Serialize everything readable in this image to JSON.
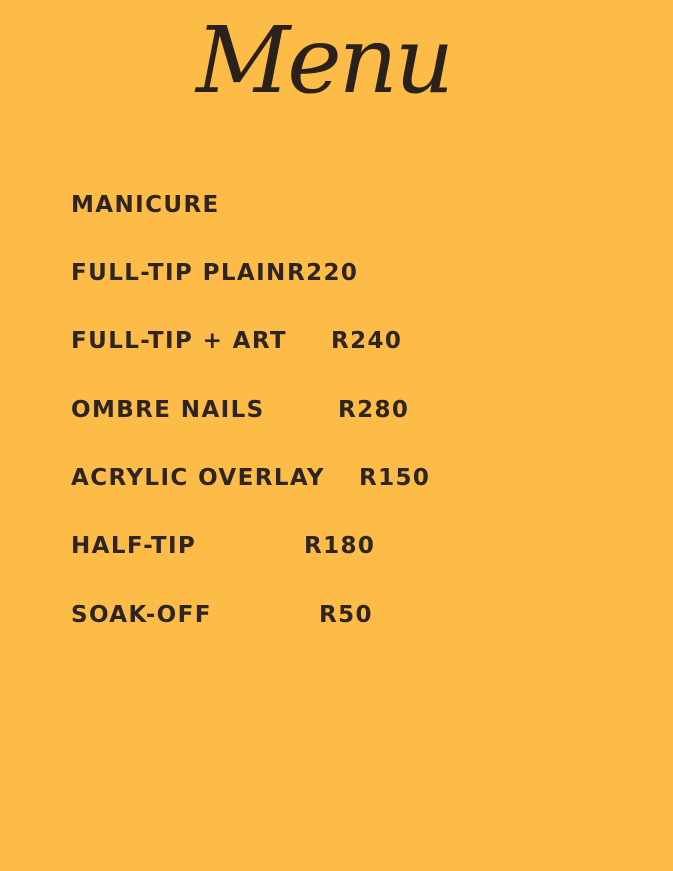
{
  "title": "Menu",
  "colors": {
    "background": "#fdbc47",
    "text": "#2e2420"
  },
  "items": [
    {
      "name": "MANICURE",
      "price": ""
    },
    {
      "name": "FULL-TIP PLAIN",
      "price": "R220"
    },
    {
      "name": "FULL-TIP + ART",
      "price": "R240"
    },
    {
      "name": "OMBRE NAILS",
      "price": "R280"
    },
    {
      "name": "ACRYLIC OVERLAY",
      "price": "R150"
    },
    {
      "name": "HALF-TIP",
      "price": "R180"
    },
    {
      "name": "SOAK-OFF",
      "price": "R50"
    }
  ]
}
